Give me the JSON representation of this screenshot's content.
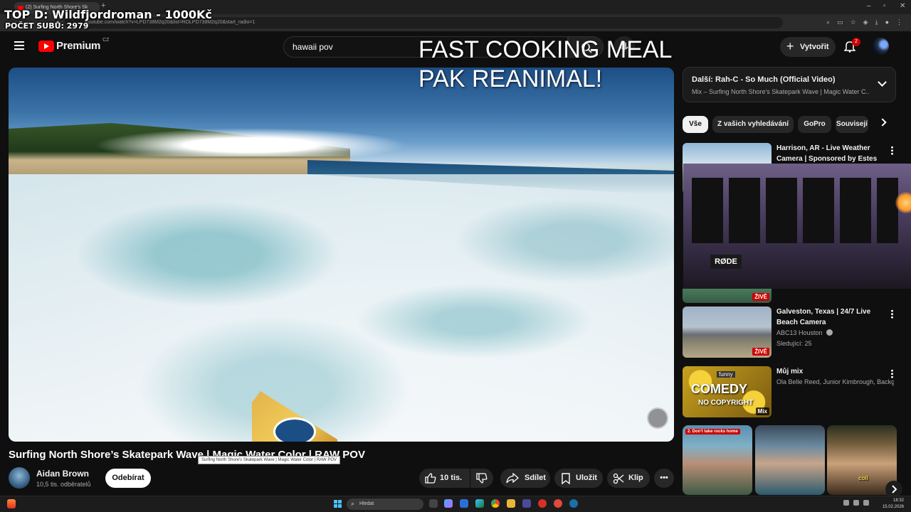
{
  "browser": {
    "tab_title": "(2) Surfing North Shore's Sk",
    "url": "youtube.com/watch?v=LPD738M2q20&list=RDLPD738M2q20&start_radio=1"
  },
  "overlay": {
    "title": "TOP D: Wildfjordroman - 1000Kč",
    "subtitle": "POČET SUBŮ: 2979",
    "big_text_line1": "FAST COOKING MEAL",
    "big_text_line2": "PAK REANIMAL!"
  },
  "header": {
    "logo_text": "Premium",
    "logo_region": "CZ",
    "search_value": "hawaii pov",
    "create_label": "Vytvořit",
    "notifications_count": "2"
  },
  "video": {
    "title": "Surfing North Shore’s Skatepark Wave | Magic Water Color | RAW POV",
    "tooltip": "Surfing North Shore's Skatepark Wave | Magic Water Color | RAW POV",
    "channel_name": "Aidan Brown",
    "channel_subs": "10,5 tis. odběratelů",
    "subscribe_label": "Odebírat",
    "like_count": "10 tis.",
    "share_label": "Sdílet",
    "save_label": "Uložit",
    "clip_label": "Klip"
  },
  "sidebar": {
    "next_title": "Další: Rah-C - So Much (Official Video)",
    "next_sub": "Mix – Surfing North Shore's Skatepark Wave | Magic Water C...",
    "chips": [
      "Vše",
      "Z vašich vyhledávání",
      "GoPro",
      "Souvisejí"
    ],
    "recs": [
      {
        "title": "Harrison, AR - Live Weather Camera | Sponsored by Estes ...",
        "meta1": "",
        "meta2": ""
      },
      {
        "title": "Galveston, Texas | 24/7 Live Beach Camera",
        "meta1": "ABC13 Houston",
        "meta2": "Sledující: 25",
        "badge": "ŽIVĚ"
      },
      {
        "title": "Můj mix",
        "meta1": "Ola Belle Reed, Junior Kimbrough, Backg...",
        "meta2": "",
        "badge": "Mix"
      }
    ],
    "live_badge_1": "ŽIVĚ",
    "thumb_text_comedy": "COMEDY",
    "thumb_text_nocopyright": "NO COPYRIGHT",
    "thumb_text_funny": "funny",
    "shorts_tag": "2. Don't take rocks home",
    "shorts_caption": "coil",
    "webcam_brand": "RØDE"
  },
  "taskbar": {
    "search_placeholder": "Hledat",
    "time": "18:32",
    "date": "15.02.2026"
  }
}
